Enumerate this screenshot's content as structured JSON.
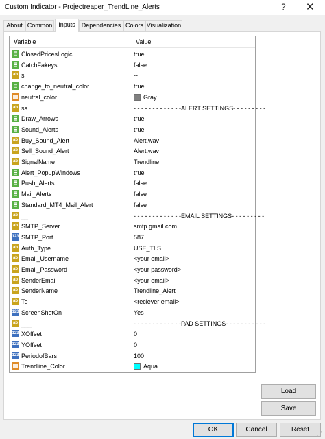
{
  "window": {
    "title": "Custom Indicator - Projectreaper_TrendLine_Alerts",
    "help_glyph": "?",
    "close_glyph": "✕"
  },
  "tabs": [
    {
      "label": "About",
      "active": false
    },
    {
      "label": "Common",
      "active": false
    },
    {
      "label": "Inputs",
      "active": true
    },
    {
      "label": "Dependencies",
      "active": false
    },
    {
      "label": "Colors",
      "active": false
    },
    {
      "label": "Visualization",
      "active": false
    }
  ],
  "grid": {
    "headers": {
      "variable": "Variable",
      "value": "Value"
    },
    "rows": [
      {
        "type": "bool",
        "icon": "",
        "name": "ClosedPricesLogic",
        "value": "true"
      },
      {
        "type": "bool",
        "icon": "",
        "name": "CatchFakeys",
        "value": "false"
      },
      {
        "type": "str",
        "icon": "ab",
        "name": "s",
        "value": "--"
      },
      {
        "type": "bool",
        "icon": "",
        "name": "change_to_neutral_color",
        "value": "true"
      },
      {
        "type": "col",
        "icon": "",
        "name": "neutral_color",
        "value": "Gray",
        "swatch": "#808080"
      },
      {
        "type": "str",
        "icon": "ab",
        "name": "ss",
        "value": "- - - - - - - - - - - - -ALERT SETTINGS- - - - - - - - -"
      },
      {
        "type": "bool",
        "icon": "",
        "name": "Draw_Arrows",
        "value": "true"
      },
      {
        "type": "bool",
        "icon": "",
        "name": "Sound_Alerts",
        "value": "true"
      },
      {
        "type": "str",
        "icon": "ab",
        "name": "Buy_Sound_Alert",
        "value": "Alert.wav"
      },
      {
        "type": "str",
        "icon": "ab",
        "name": "Sell_Sound_Alert",
        "value": "Alert.wav"
      },
      {
        "type": "str",
        "icon": "ab",
        "name": "SignalName",
        "value": "Trendline"
      },
      {
        "type": "bool",
        "icon": "",
        "name": "Alert_PopupWindows",
        "value": "true"
      },
      {
        "type": "bool",
        "icon": "",
        "name": "Push_Alerts",
        "value": "false"
      },
      {
        "type": "bool",
        "icon": "",
        "name": "Mail_Alerts",
        "value": "false"
      },
      {
        "type": "bool",
        "icon": "",
        "name": "Standard_MT4_Mail_Alert",
        "value": "false"
      },
      {
        "type": "str",
        "icon": "ab",
        "name": "__",
        "value": "- - - - - - - - - - - - -EMAIL SETTINGS- - - - - - - - -"
      },
      {
        "type": "str",
        "icon": "ab",
        "name": "SMTP_Server",
        "value": "smtp.gmail.com"
      },
      {
        "type": "int",
        "icon": "123",
        "name": "SMTP_Port",
        "value": "587"
      },
      {
        "type": "str",
        "icon": "ab",
        "name": "Auth_Type",
        "value": "USE_TLS"
      },
      {
        "type": "str",
        "icon": "ab",
        "name": "Email_Username",
        "value": "<your email>"
      },
      {
        "type": "str",
        "icon": "ab",
        "name": "Email_Password",
        "value": "<your password>"
      },
      {
        "type": "str",
        "icon": "ab",
        "name": "SenderEmail",
        "value": "<your email>"
      },
      {
        "type": "str",
        "icon": "ab",
        "name": "SenderName",
        "value": "Trendline_Alert"
      },
      {
        "type": "str",
        "icon": "ab",
        "name": "To",
        "value": "<reciever email>"
      },
      {
        "type": "int",
        "icon": "123",
        "name": "ScreenShotOn",
        "value": "Yes"
      },
      {
        "type": "str",
        "icon": "ab",
        "name": "___",
        "value": "- - - - - - - - - - - - -PAD SETTINGS- - - - - - - - - - -"
      },
      {
        "type": "int",
        "icon": "123",
        "name": "XOffset",
        "value": "0"
      },
      {
        "type": "int",
        "icon": "123",
        "name": "YOffset",
        "value": "0"
      },
      {
        "type": "int",
        "icon": "123",
        "name": "PeriodofBars",
        "value": "100"
      },
      {
        "type": "col",
        "icon": "",
        "name": "Trendline_Color",
        "value": "Aqua",
        "swatch": "#00ffff"
      }
    ]
  },
  "side_buttons": {
    "load": "Load",
    "save": "Save"
  },
  "footer_buttons": {
    "ok": "OK",
    "cancel": "Cancel",
    "reset": "Reset"
  }
}
